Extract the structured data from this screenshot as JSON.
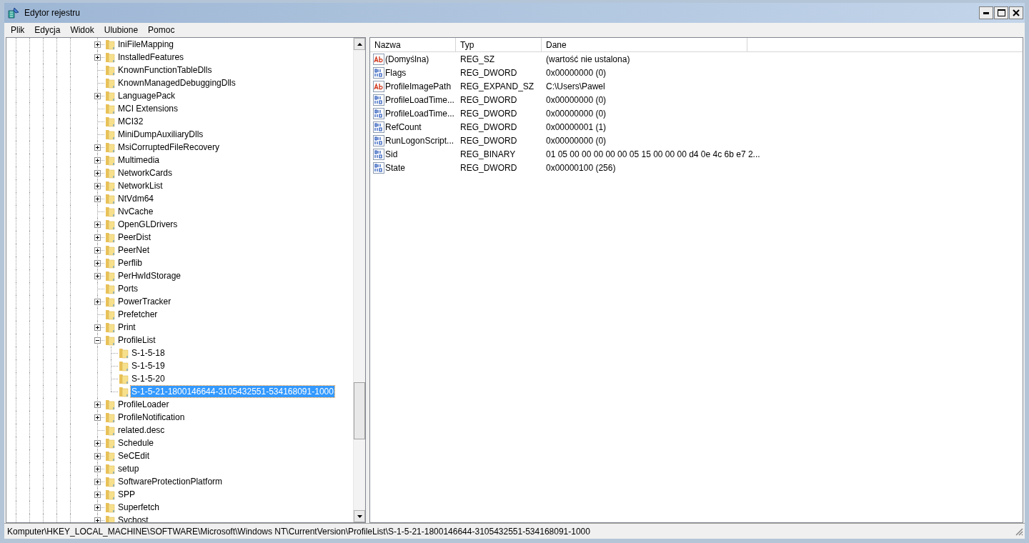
{
  "window": {
    "title": "Edytor rejestru"
  },
  "menu": [
    "Plik",
    "Edycja",
    "Widok",
    "Ulubione",
    "Pomoc"
  ],
  "tree": {
    "items": [
      {
        "label": "IniFileMapping",
        "kind": "collapsed",
        "selected": false
      },
      {
        "label": "InstalledFeatures",
        "kind": "collapsed",
        "selected": false
      },
      {
        "label": "KnownFunctionTableDlls",
        "kind": "leaf",
        "selected": false
      },
      {
        "label": "KnownManagedDebuggingDlls",
        "kind": "leaf",
        "selected": false
      },
      {
        "label": "LanguagePack",
        "kind": "collapsed",
        "selected": false
      },
      {
        "label": "MCI Extensions",
        "kind": "leaf",
        "selected": false
      },
      {
        "label": "MCI32",
        "kind": "leaf",
        "selected": false
      },
      {
        "label": "MiniDumpAuxiliaryDlls",
        "kind": "leaf",
        "selected": false
      },
      {
        "label": "MsiCorruptedFileRecovery",
        "kind": "collapsed",
        "selected": false
      },
      {
        "label": "Multimedia",
        "kind": "collapsed",
        "selected": false
      },
      {
        "label": "NetworkCards",
        "kind": "collapsed",
        "selected": false
      },
      {
        "label": "NetworkList",
        "kind": "collapsed",
        "selected": false
      },
      {
        "label": "NtVdm64",
        "kind": "collapsed",
        "selected": false
      },
      {
        "label": "NvCache",
        "kind": "leaf",
        "selected": false
      },
      {
        "label": "OpenGLDrivers",
        "kind": "collapsed",
        "selected": false
      },
      {
        "label": "PeerDist",
        "kind": "collapsed",
        "selected": false
      },
      {
        "label": "PeerNet",
        "kind": "collapsed",
        "selected": false
      },
      {
        "label": "Perflib",
        "kind": "collapsed",
        "selected": false
      },
      {
        "label": "PerHwIdStorage",
        "kind": "collapsed",
        "selected": false
      },
      {
        "label": "Ports",
        "kind": "leaf",
        "selected": false
      },
      {
        "label": "PowerTracker",
        "kind": "collapsed",
        "selected": false
      },
      {
        "label": "Prefetcher",
        "kind": "leaf",
        "selected": false
      },
      {
        "label": "Print",
        "kind": "collapsed",
        "selected": false
      },
      {
        "label": "ProfileList",
        "kind": "expanded",
        "selected": false,
        "children": [
          {
            "label": "S-1-5-18",
            "selected": false
          },
          {
            "label": "S-1-5-19",
            "selected": false
          },
          {
            "label": "S-1-5-20",
            "selected": false
          },
          {
            "label": "S-1-5-21-1800146644-3105432551-534168091-1000",
            "selected": true
          }
        ]
      },
      {
        "label": "ProfileLoader",
        "kind": "collapsed",
        "selected": false
      },
      {
        "label": "ProfileNotification",
        "kind": "collapsed",
        "selected": false
      },
      {
        "label": "related.desc",
        "kind": "leaf",
        "selected": false
      },
      {
        "label": "Schedule",
        "kind": "collapsed",
        "selected": false
      },
      {
        "label": "SeCEdit",
        "kind": "collapsed",
        "selected": false
      },
      {
        "label": "setup",
        "kind": "collapsed",
        "selected": false
      },
      {
        "label": "SoftwareProtectionPlatform",
        "kind": "collapsed",
        "selected": false
      },
      {
        "label": "SPP",
        "kind": "collapsed",
        "selected": false
      },
      {
        "label": "Superfetch",
        "kind": "collapsed",
        "selected": false
      },
      {
        "label": "Svchost",
        "kind": "collapsed",
        "selected": false
      }
    ]
  },
  "values": {
    "columns": [
      "Nazwa",
      "Typ",
      "Dane"
    ],
    "rows": [
      {
        "kind": "string",
        "name": "(Domyślna)",
        "type": "REG_SZ",
        "data": "(wartość nie ustalona)"
      },
      {
        "kind": "binary",
        "name": "Flags",
        "type": "REG_DWORD",
        "data": "0x00000000 (0)"
      },
      {
        "kind": "string",
        "name": "ProfileImagePath",
        "type": "REG_EXPAND_SZ",
        "data": "C:\\Users\\Pawel"
      },
      {
        "kind": "binary",
        "name": "ProfileLoadTime...",
        "type": "REG_DWORD",
        "data": "0x00000000 (0)"
      },
      {
        "kind": "binary",
        "name": "ProfileLoadTime...",
        "type": "REG_DWORD",
        "data": "0x00000000 (0)"
      },
      {
        "kind": "binary",
        "name": "RefCount",
        "type": "REG_DWORD",
        "data": "0x00000001 (1)"
      },
      {
        "kind": "binary",
        "name": "RunLogonScript...",
        "type": "REG_DWORD",
        "data": "0x00000000 (0)"
      },
      {
        "kind": "binary",
        "name": "Sid",
        "type": "REG_BINARY",
        "data": "01 05 00 00 00 00 00 05 15 00 00 00 d4 0e 4c 6b e7 2..."
      },
      {
        "kind": "binary",
        "name": "State",
        "type": "REG_DWORD",
        "data": "0x00000100 (256)"
      }
    ]
  },
  "status_bar": "Komputer\\HKEY_LOCAL_MACHINE\\SOFTWARE\\Microsoft\\Windows NT\\CurrentVersion\\ProfileList\\S-1-5-21-1800146644-3105432551-534168091-1000"
}
